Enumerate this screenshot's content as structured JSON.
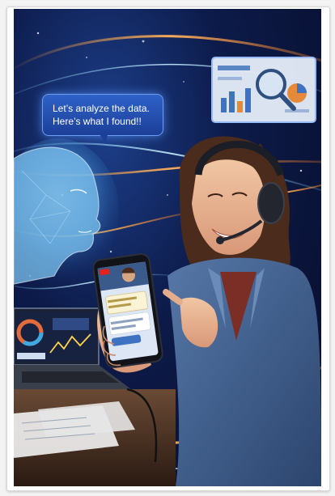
{
  "speech_bubble": {
    "line1": "Let’s analyze the data.",
    "line2": "Here’s what I found!!"
  },
  "colors": {
    "background_deep": "#070d28",
    "background_glow": "#1d3f8a",
    "bubble": "#2f62c8",
    "swirl_orange": "#ff9a3c",
    "swirl_cyan": "#7fd4ff",
    "denim": "#3d5f8f",
    "phone_live": "#e2231a"
  },
  "icons": [
    "magnifier-icon",
    "live-badge"
  ]
}
